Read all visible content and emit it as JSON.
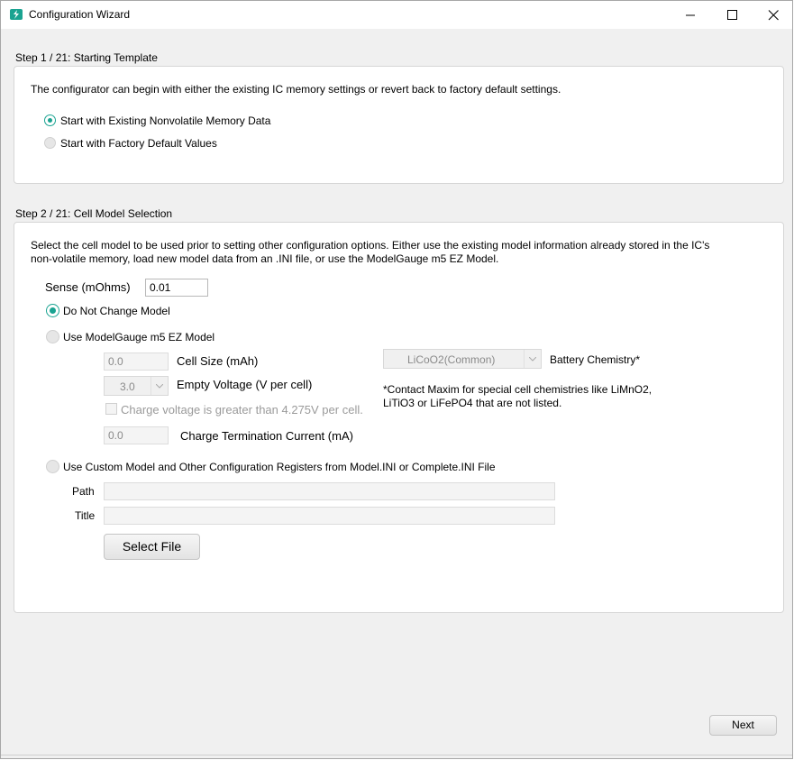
{
  "window": {
    "title": "Configuration Wizard"
  },
  "step1": {
    "title": "Step 1 / 21: Starting Template",
    "description": "The configurator can begin with either the existing IC memory settings or revert back to factory default settings.",
    "options": [
      {
        "label": "Start with Existing Nonvolatile Memory Data",
        "selected": true
      },
      {
        "label": "Start with Factory Default Values",
        "selected": false
      }
    ]
  },
  "step2": {
    "title": "Step 2 / 21: Cell Model Selection",
    "description_line1": "Select the cell model to be used prior to setting other configuration options. Either use the existing model information already stored in the IC's",
    "description_line2": "non-volatile memory, load new model data from an .INI file, or use the ModelGauge m5 EZ Model.",
    "sense_label": "Sense (mOhms)",
    "sense_value": "0.01",
    "option_no_change": "Do Not Change Model",
    "option_ez": "Use ModelGauge m5 EZ Model",
    "cell_size_label": "Cell Size (mAh)",
    "cell_size_value": "0.0",
    "empty_voltage_label": "Empty Voltage (V per cell)",
    "empty_voltage_value": "3.0",
    "charge_voltage_label": "Charge voltage is greater than 4.275V per cell.",
    "charge_term_label": "Charge Termination Current (mA)",
    "charge_term_value": "0.0",
    "chemistry_value": "LiCoO2(Common)",
    "chemistry_label": "Battery Chemistry*",
    "contact_note_line1": "*Contact Maxim for special cell chemistries like LiMnO2,",
    "contact_note_line2": "LiTiO3 or LiFePO4 that are not listed.",
    "option_custom": "Use Custom Model and Other Configuration Registers from Model.INI or Complete.INI File",
    "path_label": "Path",
    "path_value": "",
    "title_label": "Title",
    "title_value": "",
    "select_file_label": "Select File"
  },
  "footer": {
    "next_label": "Next"
  },
  "colors": {
    "accent": "#1aa391",
    "panel_bg": "#ffffff",
    "window_bg": "#f0f0f0"
  }
}
